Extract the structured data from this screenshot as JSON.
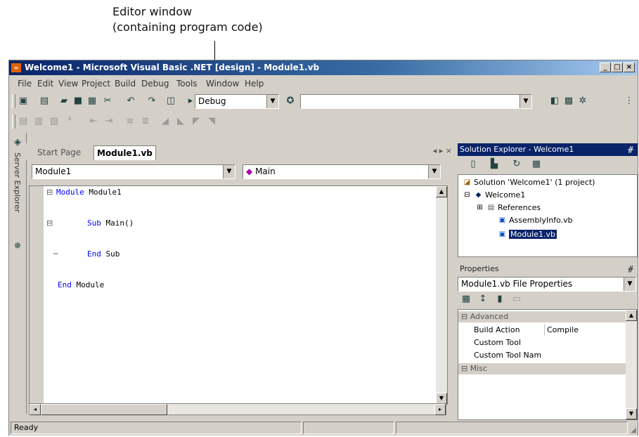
{
  "callout": {
    "line1": "Editor window",
    "line2": "(containing program code)"
  },
  "window": {
    "title": "Welcome1 - Microsoft Visual Basic .NET [design] - Module1.vb",
    "minimize": "_",
    "maximize": "□",
    "close": "×"
  },
  "menu": [
    "File",
    "Edit",
    "View",
    "Project",
    "Build",
    "Debug",
    "Tools",
    "Window",
    "Help"
  ],
  "toolbar": {
    "config": "Debug"
  },
  "left_tabs": {
    "server_explorer": "Server Explorer"
  },
  "editor": {
    "tabs": [
      "Start Page",
      "Module1.vb"
    ],
    "nav_buttons": "◂ ▸ ×",
    "class_combo": "Module1",
    "method_combo": "Main",
    "code": [
      {
        "kw": "Module",
        "text": " Module1"
      },
      {
        "kw": "Sub",
        "text": " Main()"
      },
      {
        "kw": "End",
        "text": " Sub"
      },
      {
        "kw": "End",
        "text": " Module"
      }
    ]
  },
  "solution_explorer": {
    "title": "Solution Explorer - Welcome1",
    "pin": "ᚌ",
    "items": [
      "Solution 'Welcome1' (1 project)",
      "Welcome1",
      "References",
      "AssemblyInfo.vb",
      "Module1.vb"
    ]
  },
  "properties": {
    "title": "Properties",
    "pin": "ᚌ",
    "object_combo": "Module1.vb File Properties",
    "category": "Advanced",
    "rows": [
      {
        "name": "Build Action",
        "value": "Compile"
      },
      {
        "name": "Custom Tool",
        "value": ""
      },
      {
        "name": "Custom Tool Namespace",
        "value": ""
      }
    ],
    "category2": "Misc"
  },
  "status": {
    "text": "Ready"
  }
}
